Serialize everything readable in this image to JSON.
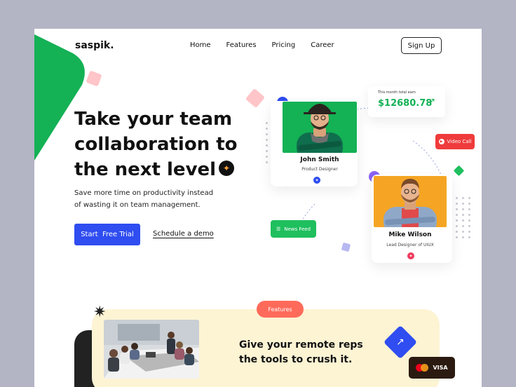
{
  "brand": {
    "logo": "saspik."
  },
  "nav": {
    "items": [
      "Home",
      "Features",
      "Pricing",
      "Career"
    ],
    "signup": "Sign Up"
  },
  "hero": {
    "title_line1": "Take your team",
    "title_line2": "collaboration to",
    "title_line3": "the next level",
    "subtitle": "Save more time on productivity instead of wasting it on team management.",
    "cta_primary": "Start  Free Trial",
    "cta_secondary": "Schedule a demo"
  },
  "profiles": [
    {
      "name": "John Smith",
      "role": "Product Designer",
      "badge_color": "#2f4df0"
    },
    {
      "name": "Mike Wilson",
      "role": "Lead Designer of UIUX",
      "badge_color": "#ef3b5c"
    }
  ],
  "earnings": {
    "label": "This month total earn",
    "amount": "$12680.78"
  },
  "widgets": {
    "video_call": "Video Call",
    "news_feed": "News Feed"
  },
  "features": {
    "pill": "Features",
    "title": "Give your remote reps the tools to crush it.",
    "card_brand": "VISA"
  },
  "colors": {
    "accent_blue": "#2f4df0",
    "green": "#14b155",
    "orange": "#f5a523",
    "red": "#ef3b3b",
    "coral": "#ff6a5a",
    "cream": "#fdf4d4"
  },
  "icons": {
    "hero_badge": "sparkle-icon",
    "earn_arrow": "arrow-up-right-icon",
    "video": "play-icon",
    "news": "list-icon",
    "feature_badge": "arrow-up-right-icon"
  }
}
